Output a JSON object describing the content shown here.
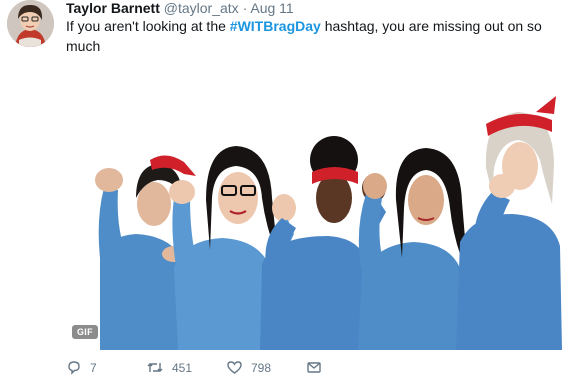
{
  "tweet": {
    "author_name": "Taylor Barnett",
    "author_handle": "@taylor_atx",
    "separator": "·",
    "time": "Aug 11",
    "text_before": "If you aren't looking at the ",
    "hashtag": "#WITBragDay",
    "text_after": " hashtag, you are missing out on so much",
    "media": {
      "badge": "GIF"
    },
    "actions": {
      "reply_count": "7",
      "retweet_count": "451",
      "like_count": "798"
    }
  },
  "colors": {
    "hashtag": "#1b95e0",
    "secondary_text": "#657786",
    "denim": "#4a86c5",
    "bandana": "#d0202a"
  },
  "icons": [
    "reply-icon",
    "retweet-icon",
    "like-icon",
    "message-icon"
  ]
}
